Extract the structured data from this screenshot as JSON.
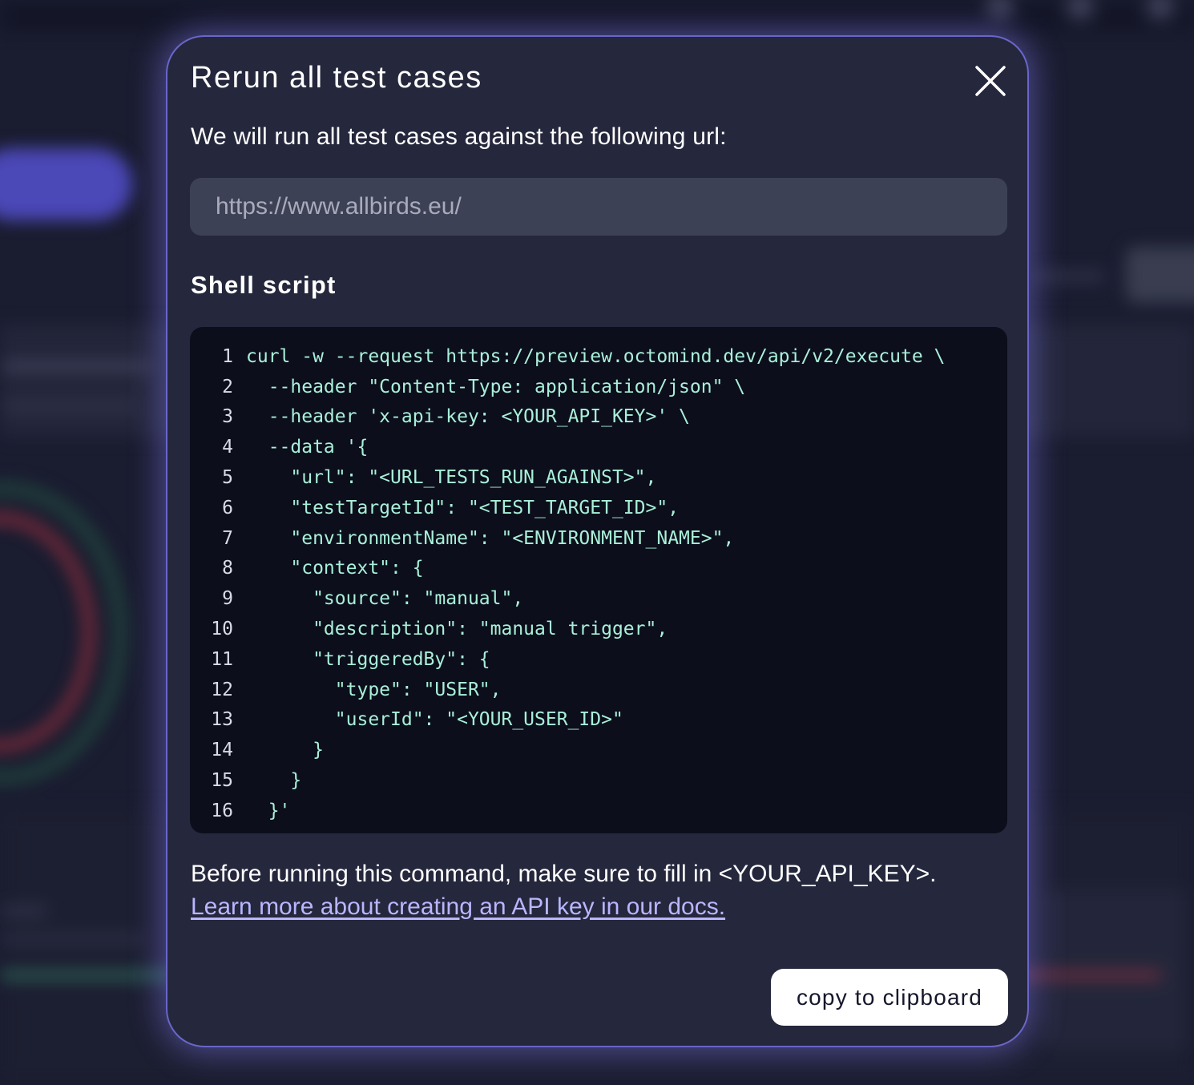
{
  "modal": {
    "title": "Rerun all test cases",
    "subtitle": "We will run all test cases against the following url:",
    "url_value": "https://www.allbirds.eu/",
    "section_heading": "Shell script",
    "code_lines": [
      {
        "num": "1",
        "code": "curl -w --request https://preview.octomind.dev/api/v2/execute \\"
      },
      {
        "num": "2",
        "code": "  --header \"Content-Type: application/json\" \\"
      },
      {
        "num": "3",
        "code": "  --header 'x-api-key: <YOUR_API_KEY>' \\"
      },
      {
        "num": "4",
        "code": "  --data '{"
      },
      {
        "num": "5",
        "code": "    \"url\": \"<URL_TESTS_RUN_AGAINST>\","
      },
      {
        "num": "6",
        "code": "    \"testTargetId\": \"<TEST_TARGET_ID>\","
      },
      {
        "num": "7",
        "code": "    \"environmentName\": \"<ENVIRONMENT_NAME>\","
      },
      {
        "num": "8",
        "code": "    \"context\": {"
      },
      {
        "num": "9",
        "code": "      \"source\": \"manual\","
      },
      {
        "num": "10",
        "code": "      \"description\": \"manual trigger\","
      },
      {
        "num": "11",
        "code": "      \"triggeredBy\": {"
      },
      {
        "num": "12",
        "code": "        \"type\": \"USER\","
      },
      {
        "num": "13",
        "code": "        \"userId\": \"<YOUR_USER_ID>\""
      },
      {
        "num": "14",
        "code": "      }"
      },
      {
        "num": "15",
        "code": "    }"
      },
      {
        "num": "16",
        "code": "  }'"
      }
    ],
    "note_text": "Before running this command, make sure to fill in <YOUR_API_KEY>.",
    "note_link": "Learn more about creating an API key in our docs.",
    "copy_button": "copy to clipboard"
  },
  "icons": {
    "close": "close-icon"
  },
  "colors": {
    "modal_bg": "#25273c",
    "modal_border": "#6a66c9",
    "code_bg": "#0c0e1c",
    "code_text": "#a9f0d8",
    "link": "#b9b6ff",
    "input_bg": "#3d4156"
  }
}
